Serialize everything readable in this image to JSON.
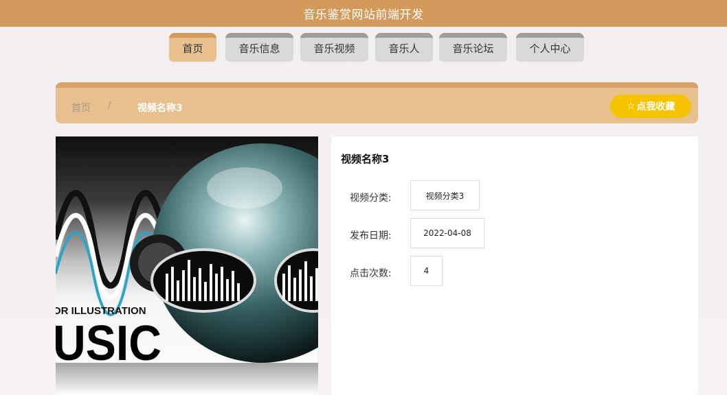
{
  "site": {
    "title": "音乐鉴赏网站前端开发"
  },
  "nav": {
    "tabs": [
      {
        "label": "首页",
        "active": true
      },
      {
        "label": "音乐信息",
        "active": false
      },
      {
        "label": "音乐视频",
        "active": false
      },
      {
        "label": "音乐人",
        "active": false
      },
      {
        "label": "音乐论坛",
        "active": false
      },
      {
        "label": "个人中心",
        "active": false
      }
    ]
  },
  "breadcrumb": {
    "home": "首页",
    "separator": "/",
    "current": "视频名称3",
    "favorite_icon": "star-outline-icon",
    "favorite_label": "点我收藏"
  },
  "media": {
    "image_text_line1": "OR ILLUSTRATION",
    "image_text_line2": "USIC"
  },
  "detail": {
    "title": "视频名称3",
    "fields": [
      {
        "label": "视频分类:",
        "value": "视频分类3"
      },
      {
        "label": "发布日期:",
        "value": "2022-04-08"
      },
      {
        "label": "点击次数:",
        "value": "4"
      }
    ]
  },
  "colors": {
    "header": "#d49a5c",
    "active_tab": "#e7c08e",
    "favorite_button": "#f5c400"
  }
}
